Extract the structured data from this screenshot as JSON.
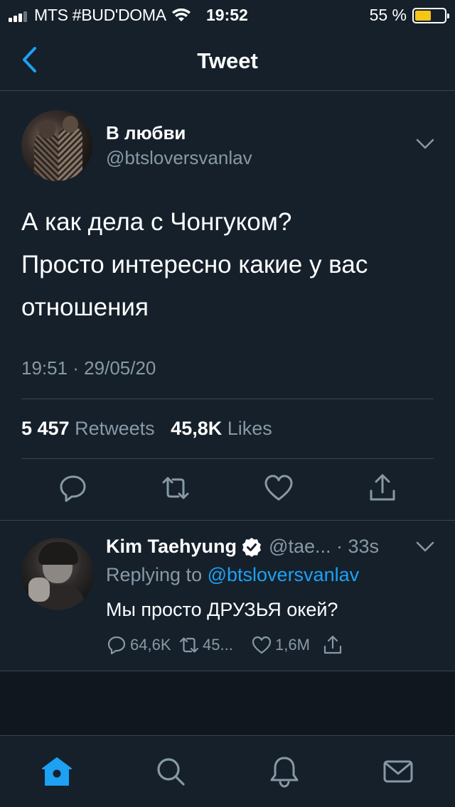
{
  "status_bar": {
    "carrier": "MTS #BUD'DOMA",
    "time": "19:52",
    "battery": "55 %",
    "battery_level": 0.55
  },
  "header": {
    "title": "Tweet",
    "back_icon": "chevron-left-icon"
  },
  "main_tweet": {
    "display_name": "В любви",
    "handle": "@btsloversvanlav",
    "text_lines": [
      "А как дела с Чонгуком?",
      "Просто интересно какие у вас",
      "отношения"
    ],
    "timestamp": "19:51 · 29/05/20",
    "retweets_count": "5 457",
    "retweets_label": "Retweets",
    "likes_count": "45,8K",
    "likes_label": "Likes",
    "actions": [
      "reply-icon",
      "retweet-icon",
      "like-icon",
      "share-icon"
    ]
  },
  "reply": {
    "display_name": "Kim Taehyung",
    "handle": "@tae...",
    "time": "· 33s",
    "replying_prefix": "Replying to",
    "replying_to": "@btsloversvanlav",
    "text": "Мы просто ДРУЗЬЯ окей?",
    "reply_count": "64,6K",
    "retweet_count": "45...",
    "like_count": "1,6M"
  },
  "tab_bar": {
    "tabs": [
      "home-icon",
      "search-icon",
      "notifications-icon",
      "messages-icon"
    ],
    "active_color": "#1da1f2",
    "inactive_color": "#8899a6"
  },
  "colors": {
    "background": "#15202b",
    "secondary_text": "#8899a6",
    "accent": "#1da1f2",
    "divider": "#38444d"
  }
}
